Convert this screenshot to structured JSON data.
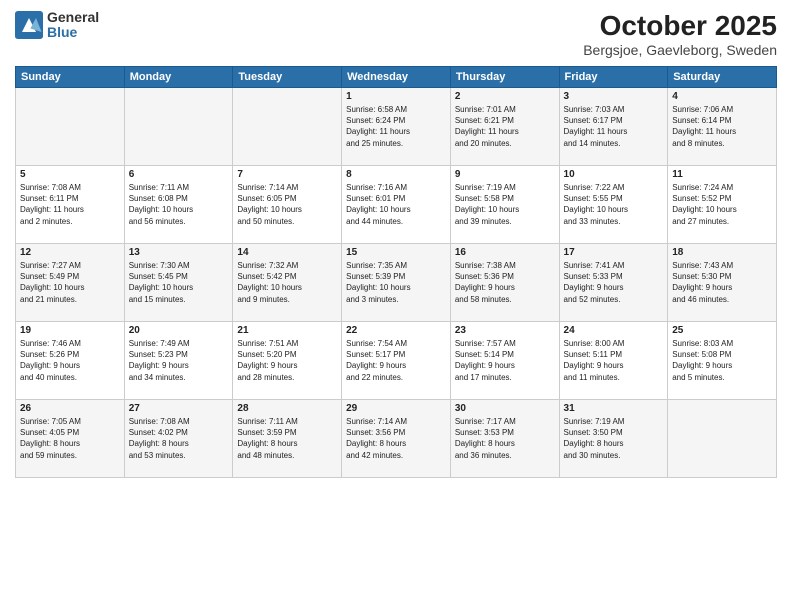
{
  "logo": {
    "general": "General",
    "blue": "Blue"
  },
  "header": {
    "month": "October 2025",
    "location": "Bergsjoe, Gaevleborg, Sweden"
  },
  "weekdays": [
    "Sunday",
    "Monday",
    "Tuesday",
    "Wednesday",
    "Thursday",
    "Friday",
    "Saturday"
  ],
  "weeks": [
    [
      {
        "day": "",
        "info": ""
      },
      {
        "day": "",
        "info": ""
      },
      {
        "day": "",
        "info": ""
      },
      {
        "day": "1",
        "info": "Sunrise: 6:58 AM\nSunset: 6:24 PM\nDaylight: 11 hours\nand 25 minutes."
      },
      {
        "day": "2",
        "info": "Sunrise: 7:01 AM\nSunset: 6:21 PM\nDaylight: 11 hours\nand 20 minutes."
      },
      {
        "day": "3",
        "info": "Sunrise: 7:03 AM\nSunset: 6:17 PM\nDaylight: 11 hours\nand 14 minutes."
      },
      {
        "day": "4",
        "info": "Sunrise: 7:06 AM\nSunset: 6:14 PM\nDaylight: 11 hours\nand 8 minutes."
      }
    ],
    [
      {
        "day": "5",
        "info": "Sunrise: 7:08 AM\nSunset: 6:11 PM\nDaylight: 11 hours\nand 2 minutes."
      },
      {
        "day": "6",
        "info": "Sunrise: 7:11 AM\nSunset: 6:08 PM\nDaylight: 10 hours\nand 56 minutes."
      },
      {
        "day": "7",
        "info": "Sunrise: 7:14 AM\nSunset: 6:05 PM\nDaylight: 10 hours\nand 50 minutes."
      },
      {
        "day": "8",
        "info": "Sunrise: 7:16 AM\nSunset: 6:01 PM\nDaylight: 10 hours\nand 44 minutes."
      },
      {
        "day": "9",
        "info": "Sunrise: 7:19 AM\nSunset: 5:58 PM\nDaylight: 10 hours\nand 39 minutes."
      },
      {
        "day": "10",
        "info": "Sunrise: 7:22 AM\nSunset: 5:55 PM\nDaylight: 10 hours\nand 33 minutes."
      },
      {
        "day": "11",
        "info": "Sunrise: 7:24 AM\nSunset: 5:52 PM\nDaylight: 10 hours\nand 27 minutes."
      }
    ],
    [
      {
        "day": "12",
        "info": "Sunrise: 7:27 AM\nSunset: 5:49 PM\nDaylight: 10 hours\nand 21 minutes."
      },
      {
        "day": "13",
        "info": "Sunrise: 7:30 AM\nSunset: 5:45 PM\nDaylight: 10 hours\nand 15 minutes."
      },
      {
        "day": "14",
        "info": "Sunrise: 7:32 AM\nSunset: 5:42 PM\nDaylight: 10 hours\nand 9 minutes."
      },
      {
        "day": "15",
        "info": "Sunrise: 7:35 AM\nSunset: 5:39 PM\nDaylight: 10 hours\nand 3 minutes."
      },
      {
        "day": "16",
        "info": "Sunrise: 7:38 AM\nSunset: 5:36 PM\nDaylight: 9 hours\nand 58 minutes."
      },
      {
        "day": "17",
        "info": "Sunrise: 7:41 AM\nSunset: 5:33 PM\nDaylight: 9 hours\nand 52 minutes."
      },
      {
        "day": "18",
        "info": "Sunrise: 7:43 AM\nSunset: 5:30 PM\nDaylight: 9 hours\nand 46 minutes."
      }
    ],
    [
      {
        "day": "19",
        "info": "Sunrise: 7:46 AM\nSunset: 5:26 PM\nDaylight: 9 hours\nand 40 minutes."
      },
      {
        "day": "20",
        "info": "Sunrise: 7:49 AM\nSunset: 5:23 PM\nDaylight: 9 hours\nand 34 minutes."
      },
      {
        "day": "21",
        "info": "Sunrise: 7:51 AM\nSunset: 5:20 PM\nDaylight: 9 hours\nand 28 minutes."
      },
      {
        "day": "22",
        "info": "Sunrise: 7:54 AM\nSunset: 5:17 PM\nDaylight: 9 hours\nand 22 minutes."
      },
      {
        "day": "23",
        "info": "Sunrise: 7:57 AM\nSunset: 5:14 PM\nDaylight: 9 hours\nand 17 minutes."
      },
      {
        "day": "24",
        "info": "Sunrise: 8:00 AM\nSunset: 5:11 PM\nDaylight: 9 hours\nand 11 minutes."
      },
      {
        "day": "25",
        "info": "Sunrise: 8:03 AM\nSunset: 5:08 PM\nDaylight: 9 hours\nand 5 minutes."
      }
    ],
    [
      {
        "day": "26",
        "info": "Sunrise: 7:05 AM\nSunset: 4:05 PM\nDaylight: 8 hours\nand 59 minutes."
      },
      {
        "day": "27",
        "info": "Sunrise: 7:08 AM\nSunset: 4:02 PM\nDaylight: 8 hours\nand 53 minutes."
      },
      {
        "day": "28",
        "info": "Sunrise: 7:11 AM\nSunset: 3:59 PM\nDaylight: 8 hours\nand 48 minutes."
      },
      {
        "day": "29",
        "info": "Sunrise: 7:14 AM\nSunset: 3:56 PM\nDaylight: 8 hours\nand 42 minutes."
      },
      {
        "day": "30",
        "info": "Sunrise: 7:17 AM\nSunset: 3:53 PM\nDaylight: 8 hours\nand 36 minutes."
      },
      {
        "day": "31",
        "info": "Sunrise: 7:19 AM\nSunset: 3:50 PM\nDaylight: 8 hours\nand 30 minutes."
      },
      {
        "day": "",
        "info": ""
      }
    ]
  ]
}
